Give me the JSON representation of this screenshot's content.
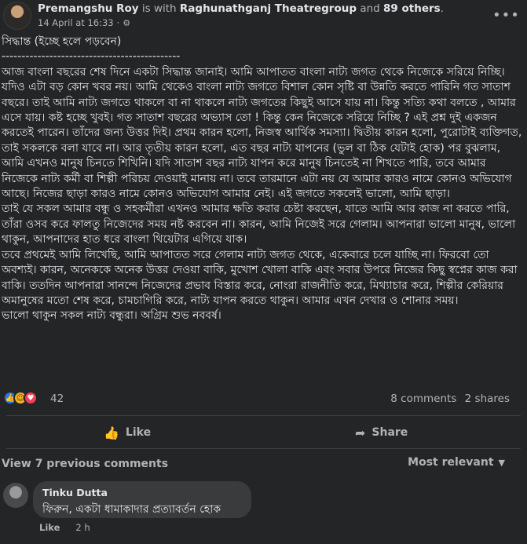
{
  "post": {
    "author": "Premangshu Roy",
    "with_text": "is with",
    "group": "Raghunathganj Theatregroup",
    "and_text": "and",
    "others": "89 others",
    "period": ".",
    "timestamp": "14 April at 16:33",
    "dot": "·",
    "more_icon": "•••",
    "body": [
      "সিদ্ধান্ত (ইচ্ছে হলে পড়বেন)",
      "---------------------------------------------",
      "আজ বাংলা বছরের শেষ দিনে একটা সিদ্ধান্ত জানাই। আমি আপাতত বাংলা নাট্য জগত থেকে নিজেকে সরিয়ে নিচ্ছি। যদিও এটা বড় কোন খবর নয়। আমি থেকেও বাংলা নাট্য জগতে বিশাল কোন সৃষ্টি বা উন্নতি করতে পারিনি গত সাতাশ বছরে। তাই আমি নাট্য জগতে থাকলে বা না থাকলে নাট্য জগতের কিছুই আসে যায় না। কিন্তু সত্যি কথা বলতে , আমার এসে যায়। কষ্ট হচ্ছে খুবই। গত সাতাশ বছরের অভ্যাস তো ! কিন্তু কেন নিজেকে সরিয়ে নিচ্ছি ? এই প্রশ্ন দুই একজন করতেই পারেন। তাঁদের জন্য উত্তর দিই। প্রথম কারন হলো, নিজস্ব আর্থিক সমস্যা। দ্বিতীয় কারন হলো, পুরোটাই ব্যক্তিগত, তাই সকলকে বলা যাবে না। আর তৃতীয় কারন হলো, এত বছর নাট্য যাপনের (ভুল বা ঠিক যেটাই হোক) পর বুঝলাম, আমি এখনও মানুষ চিনতে শিখিনি। যদি সাতাশ বছর নাট্য যাপন করে মানুষ চিনতেই না শিখতে পারি, তবে আমার নিজেকে নাট্য কর্মী বা শিল্পী পরিচয় দেওয়াই মানায় না। তবে তারমানে এটা নয় যে আমার কারও নামে কোনও অভিযোগ আছে। নিজের ছাড়া কারও নামে কোনও অভিযোগ আমার নেই। এই জগতে সকলেই ভালো, আমি ছাড়া।",
      "তাই যে সকল আমার বন্ধু ও সহকর্মীরা এখনও আমার ক্ষতি করার চেষ্টা করছেন, যাতে আমি আর কাজ না করতে পারি, তাঁরা ওসব করে ফালতু নিজেদের সময় নষ্ট করবেন না। কারন, আমি নিজেই সরে গেলাম। আপনারা ভালো মানুষ, ভালো থাকুন, আপনাদের হাত ধরে বাংলা থিয়েটার এগিয়ে যাক।",
      "তবে প্রথমেই আমি লিখেছি, আমি আপাতত সরে গেলাম নাট্য জগত থেকে, একেবারে চলে যাচ্ছি না। ফিরবো তো অবশ্যই। কারন, অনেককে অনেক উত্তর দেওয়া বাকি, মুখোশ খোলা বাকি এবং সবার উপরে নিজের কিছু স্বপ্নের কাজ করা বাকি। ততদিন আপনারা সানন্দে নিজেদের প্রভাব বিস্তার করে, নোংরা রাজনীতি করে, মিথ্যাচার করে, শিল্পীর কেরিয়ার অমানুষের মতো শেষ করে, চামচাগিরি করে,  নাট্য যাপন করতে থাকুন। আমার এখন দেখার ও শোনার সময়।",
      "ভালো থাকুন সকল নাট্য বন্ধুরা। অগ্রিম শুভ নববর্ষ।"
    ]
  },
  "reactions": {
    "icons": [
      "like-icon",
      "care-icon",
      "love-icon"
    ],
    "count": "42",
    "comments": "8 comments",
    "shares": "2 shares"
  },
  "actions": {
    "like_label": "Like",
    "share_label": "Share"
  },
  "comments": {
    "view_previous": "View 7 previous comments",
    "sort_label": "Most relevant",
    "items": [
      {
        "author": "Tinku Dutta",
        "text": "ফিরুন, একটা ধামাকাদার প্রত্যাবর্তন হোক",
        "like_label": "Like",
        "age": "2 h"
      }
    ]
  },
  "colors": {
    "background": "#242526",
    "text": "#e4e6eb",
    "secondary": "#b0b3b8",
    "like_blue": "#2078f4"
  }
}
